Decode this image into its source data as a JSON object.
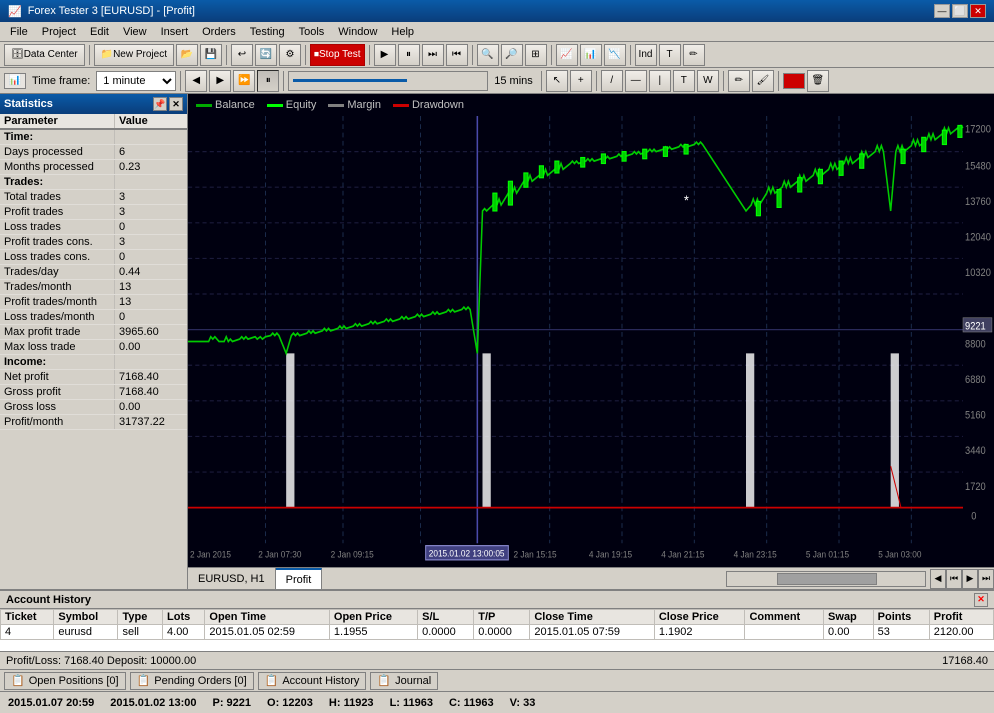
{
  "titleBar": {
    "title": "Forex Tester 3 [EURUSD] - [Profit]",
    "icon": "📈",
    "controls": [
      "—",
      "⬜",
      "✕"
    ]
  },
  "menuBar": {
    "items": [
      "File",
      "Project",
      "Edit",
      "View",
      "Insert",
      "Orders",
      "Testing",
      "Tools",
      "Window",
      "Help"
    ]
  },
  "toolbar1": {
    "datacenter": "Data Center",
    "newproject": "New Project",
    "stoptest": "Stop Test"
  },
  "toolbar2": {
    "timeframe_label": "Time frame:",
    "timeframe_value": "1 minute",
    "duration": "15 mins"
  },
  "statistics": {
    "title": "Statistics",
    "columns": {
      "parameter": "Parameter",
      "value": "Value"
    },
    "rows": [
      {
        "param": "Time:",
        "value": "",
        "bold": true
      },
      {
        "param": "Days processed",
        "value": "6",
        "bold": false
      },
      {
        "param": "Months processed",
        "value": "0.23",
        "bold": false
      },
      {
        "param": "Trades:",
        "value": "",
        "bold": true
      },
      {
        "param": "Total trades",
        "value": "3",
        "bold": false
      },
      {
        "param": "Profit trades",
        "value": "3",
        "bold": false
      },
      {
        "param": "Loss trades",
        "value": "0",
        "bold": false
      },
      {
        "param": "Profit trades cons.",
        "value": "3",
        "bold": false
      },
      {
        "param": "Loss trades cons.",
        "value": "0",
        "bold": false
      },
      {
        "param": "Trades/day",
        "value": "0.44",
        "bold": false
      },
      {
        "param": "Trades/month",
        "value": "13",
        "bold": false
      },
      {
        "param": "Profit trades/month",
        "value": "13",
        "bold": false
      },
      {
        "param": "Loss trades/month",
        "value": "0",
        "bold": false
      },
      {
        "param": "Max profit trade",
        "value": "3965.60",
        "bold": false
      },
      {
        "param": "Max loss trade",
        "value": "0.00",
        "bold": false
      },
      {
        "param": "Income:",
        "value": "",
        "bold": true
      },
      {
        "param": "Net profit",
        "value": "7168.40",
        "bold": false
      },
      {
        "param": "Gross profit",
        "value": "7168.40",
        "bold": false
      },
      {
        "param": "Gross loss",
        "value": "0.00",
        "bold": false
      },
      {
        "param": "Profit/month",
        "value": "31737.22",
        "bold": false
      }
    ]
  },
  "legend": {
    "items": [
      {
        "label": "Balance",
        "color": "#00aa00"
      },
      {
        "label": "Equity",
        "color": "#00ff00"
      },
      {
        "label": "Margin",
        "color": "#808080"
      },
      {
        "label": "Drawdown",
        "color": "#cc0000"
      }
    ]
  },
  "chartTabs": {
    "items": [
      "EURUSD, H1",
      "Profit"
    ],
    "active": 1
  },
  "xAxisLabels": [
    "2 Jan 2015",
    "2 Jan 07:30",
    "2 Jan 09:15",
    "2015.01.02 13:00:05",
    "2 Jan 15:15",
    "4 Jan 19:15",
    "4 Jan 21:15",
    "4 Jan 23:15",
    "5 Jan 01:15",
    "5 Jan 03:00"
  ],
  "yAxisLabels": [
    "17200",
    "15480",
    "13760",
    "12040",
    "10320",
    "9221",
    "8800",
    "6880",
    "5160",
    "3440",
    "1720",
    "0"
  ],
  "accountHistory": {
    "title": "Account History",
    "columns": [
      "Ticket",
      "Symbol",
      "Type",
      "Lots",
      "Open Time",
      "Open Price",
      "S/L",
      "T/P",
      "Close Time",
      "Close Price",
      "Comment",
      "Swap",
      "Points",
      "Profit"
    ],
    "rows": [
      {
        "ticket": "4",
        "symbol": "eurusd",
        "type": "sell",
        "lots": "4.00",
        "openTime": "2015.01.05 02:59",
        "openPrice": "1.1955",
        "sl": "0.0000",
        "tp": "0.0000",
        "closeTime": "2015.01.05 07:59",
        "closePrice": "1.1902",
        "comment": "",
        "swap": "0.00",
        "points": "53",
        "profit": "2120.00"
      }
    ],
    "footer_pl": "Profit/Loss: 7168.40 Deposit: 10000.00",
    "footer_total": "17168.40"
  },
  "bottomTabs": [
    {
      "label": "Open Positions [0]",
      "icon": "📋"
    },
    {
      "label": "Pending Orders [0]",
      "icon": "📋"
    },
    {
      "label": "Account History",
      "icon": "📋"
    },
    {
      "label": "Journal",
      "icon": "📋"
    }
  ],
  "statusBar": {
    "datetime": "2015.01.07 20:59",
    "chart_time": "2015.01.02 13:00",
    "price_p": "P: 9221",
    "price_o": "O: 12203",
    "price_h": "H: 11923",
    "price_l": "L: 11963",
    "price_c": "C: 11963",
    "volume": "V: 33"
  }
}
